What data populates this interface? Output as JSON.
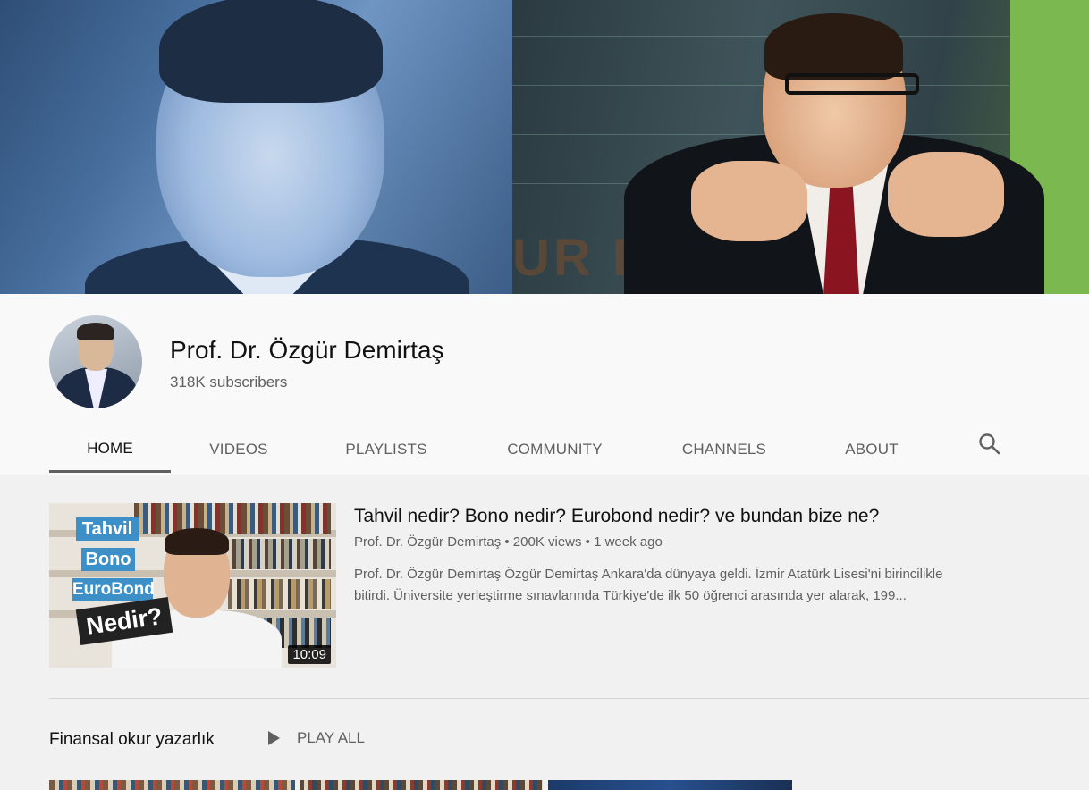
{
  "channel": {
    "name": "Prof. Dr. Özgür Demirtaş",
    "subscribers": "318K subscribers",
    "banner_text": "UR D"
  },
  "tabs": [
    {
      "label": "HOME",
      "active": true
    },
    {
      "label": "VIDEOS",
      "active": false
    },
    {
      "label": "PLAYLISTS",
      "active": false
    },
    {
      "label": "COMMUNITY",
      "active": false
    },
    {
      "label": "CHANNELS",
      "active": false
    },
    {
      "label": "ABOUT",
      "active": false
    }
  ],
  "search_icon": "search-icon",
  "featured_video": {
    "title": "Tahvil nedir? Bono nedir? Eurobond nedir? ve bundan bize ne?",
    "meta": "Prof. Dr. Özgür Demirtaş • 200K views • 1 week ago",
    "description_line1": "Prof. Dr. Özgür Demirtaş Özgür Demirtaş Ankara'da dünyaya geldi. İzmir Atatürk Lisesi'ni birincilikle",
    "description_line2": "bitirdi. Üniversite yerleştirme sınavlarında Türkiye'de ilk 50 öğrenci arasında yer alarak, 199...",
    "duration": "10:09",
    "thumbnail_tags": [
      "Tahvil",
      "Bono",
      "EuroBond",
      "Nedir?"
    ]
  },
  "shelf": {
    "title": "Finansal okur yazarlık",
    "play_all": "PLAY ALL"
  },
  "colors": {
    "tag_blue": "#3d8fc8",
    "banner_green": "#7bb84f",
    "text_secondary": "#606060"
  }
}
